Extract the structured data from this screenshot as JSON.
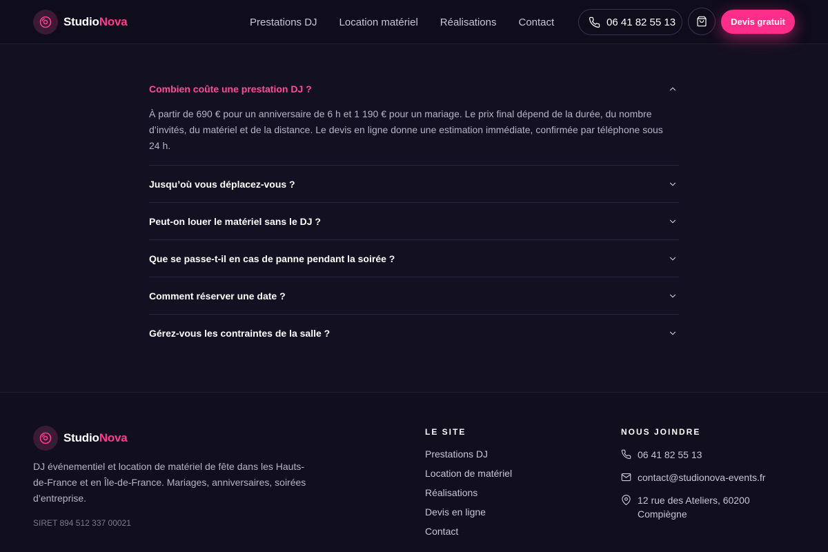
{
  "brand": {
    "name_part1": "Studio",
    "name_part2": "Nova",
    "accent_color": "#ff2e8b"
  },
  "nav": {
    "items": [
      {
        "label": "Prestations DJ"
      },
      {
        "label": "Location matériel"
      },
      {
        "label": "Réalisations"
      },
      {
        "label": "Contact"
      }
    ],
    "phone": "06 41 82 55 13",
    "cart_icon": "shopping-bag-icon",
    "cta_label": "Devis gratuit"
  },
  "faq": {
    "items": [
      {
        "question": "Combien coûte une prestation DJ ?",
        "answer": "À partir de 690 € pour un anniversaire de 6 h et 1 190 € pour un mariage. Le prix final dépend de la durée, du nombre d’invités, du matériel et de la distance. Le devis en ligne donne une estimation immédiate, confirmée par téléphone sous 24 h.",
        "open": true
      },
      {
        "question": "Jusqu’où vous déplacez-vous ?",
        "open": false
      },
      {
        "question": "Peut-on louer le matériel sans le DJ ?",
        "open": false
      },
      {
        "question": "Que se passe-t-il en cas de panne pendant la soirée ?",
        "open": false
      },
      {
        "question": "Comment réserver une date ?",
        "open": false
      },
      {
        "question": "Gérez-vous les contraintes de la salle ?",
        "open": false
      }
    ]
  },
  "footer": {
    "description": "DJ événementiel et location de matériel de fête dans les Hauts-de-France et en Île-de-France. Mariages, anniversaires, soirées d’entreprise.",
    "siret": "SIRET 894 512 337 00021",
    "site_title": "LE SITE",
    "site_links": [
      {
        "label": "Prestations DJ"
      },
      {
        "label": "Location de matériel"
      },
      {
        "label": "Réalisations"
      },
      {
        "label": "Devis en ligne"
      },
      {
        "label": "Contact"
      }
    ],
    "contact_title": "NOUS JOINDRE",
    "phone": "06 41 82 55 13",
    "email": "contact@studionova-events.fr",
    "address": "12 rue des Ateliers, 60200 Compiègne"
  }
}
